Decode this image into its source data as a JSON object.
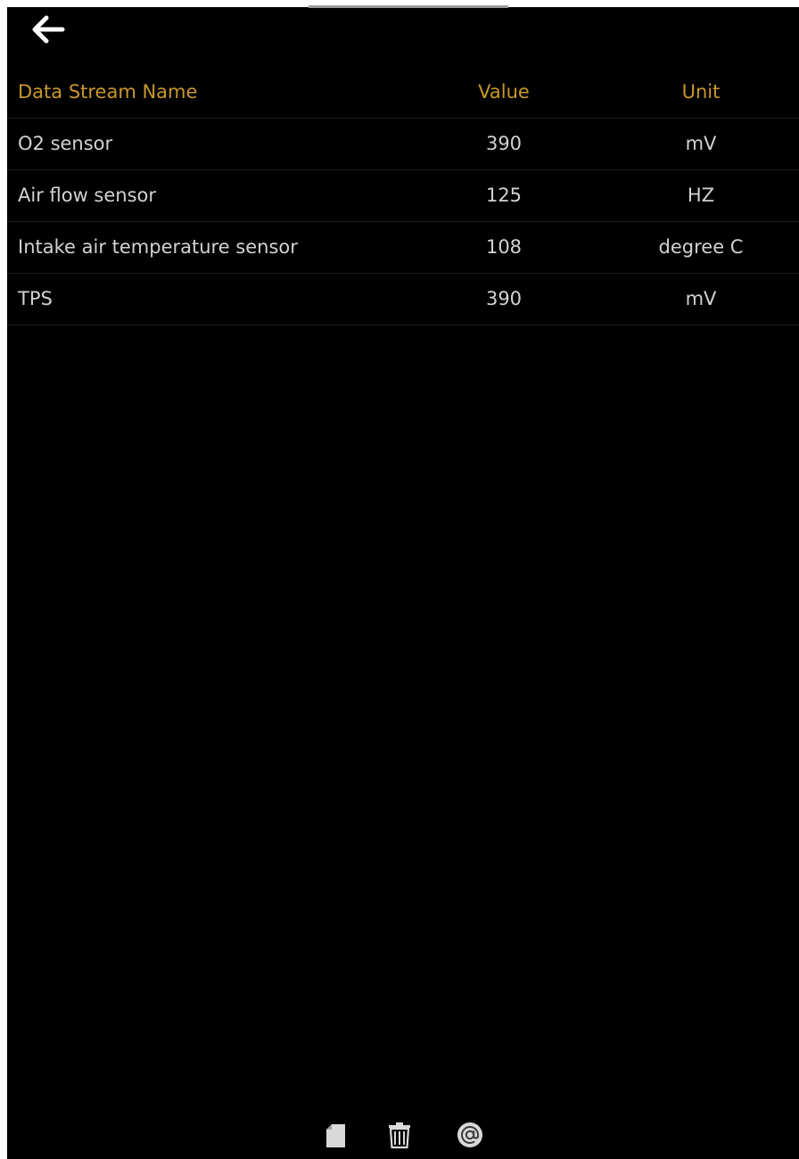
{
  "table": {
    "headers": {
      "name": "Data Stream Name",
      "value": "Value",
      "unit": "Unit"
    },
    "rows": [
      {
        "name": "O2 sensor",
        "value": "390",
        "unit": "mV"
      },
      {
        "name": "Air flow sensor",
        "value": "125",
        "unit": "HZ"
      },
      {
        "name": "Intake air temperature sensor",
        "value": "108",
        "unit": "degree C"
      },
      {
        "name": "TPS",
        "value": "390",
        "unit": "mV"
      }
    ]
  },
  "icons": {
    "back": "arrow-left-icon",
    "document": "document-icon",
    "trash": "trash-icon",
    "email": "at-sign-icon"
  },
  "colors": {
    "background": "#000000",
    "header_text": "#c9972c",
    "row_text": "#d2d2d2",
    "divider": "#1c1c1c"
  }
}
